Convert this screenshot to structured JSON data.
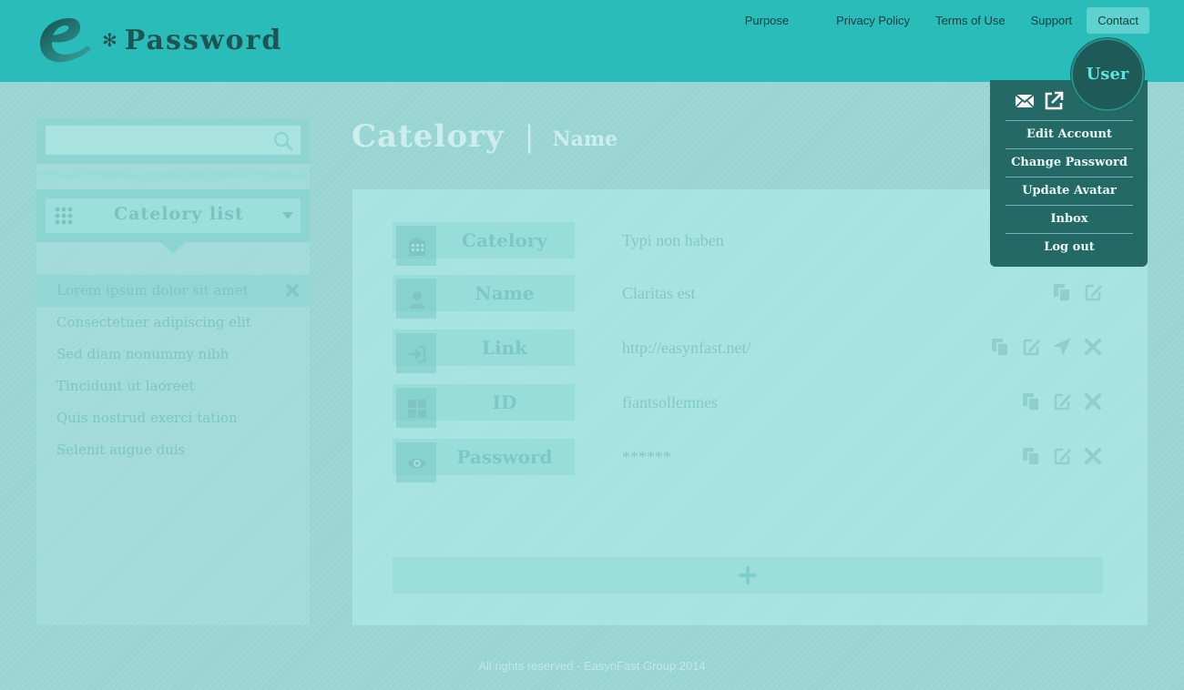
{
  "brand": {
    "star": "✻",
    "name": "Password"
  },
  "nav": {
    "items": [
      {
        "label": "Purpose"
      },
      {
        "label": "Privacy Policy"
      },
      {
        "label": "Terms of Use"
      },
      {
        "label": "Support"
      },
      {
        "label": "Contact",
        "active": true
      }
    ]
  },
  "search": {
    "placeholder": "",
    "value": ""
  },
  "sidebar": {
    "title": "Catelory list",
    "items": [
      {
        "label": "Lorem ipsum dolor sit amet",
        "selected": true
      },
      {
        "label": "Consectetuer adipiscing elit"
      },
      {
        "label": "Sed diam nonummy nibh"
      },
      {
        "label": "Tincidunt ut laoreet"
      },
      {
        "label": "Quis nostrud exerci tation"
      },
      {
        "label": "Selenit augue duis"
      }
    ]
  },
  "main": {
    "title": "Catelory",
    "separator": "|",
    "subtitle": "Name",
    "fields": [
      {
        "label": "Catelory",
        "value": "Typi non haben",
        "icon": "building-icon"
      },
      {
        "label": "Name",
        "value": "Claritas est",
        "icon": "person-icon"
      },
      {
        "label": "Link",
        "value": "http://easynfast.net/",
        "icon": "login-icon"
      },
      {
        "label": "ID",
        "value": "fiantsollemnes",
        "icon": "grid-icon"
      },
      {
        "label": "Password",
        "value": "******",
        "icon": "eye-icon"
      }
    ]
  },
  "user": {
    "label": "User",
    "menu": [
      {
        "label": "Edit Account"
      },
      {
        "label": "Change Password"
      },
      {
        "label": "Update Avatar"
      },
      {
        "label": "Inbox"
      },
      {
        "label": "Log out"
      }
    ]
  },
  "footer": {
    "text": "All rights reserved - EasynFast Group 2014"
  },
  "colors": {
    "header": "#29bcb9",
    "background": "#97d4d2",
    "menu": "#256966",
    "accent": "#5be3dc"
  }
}
